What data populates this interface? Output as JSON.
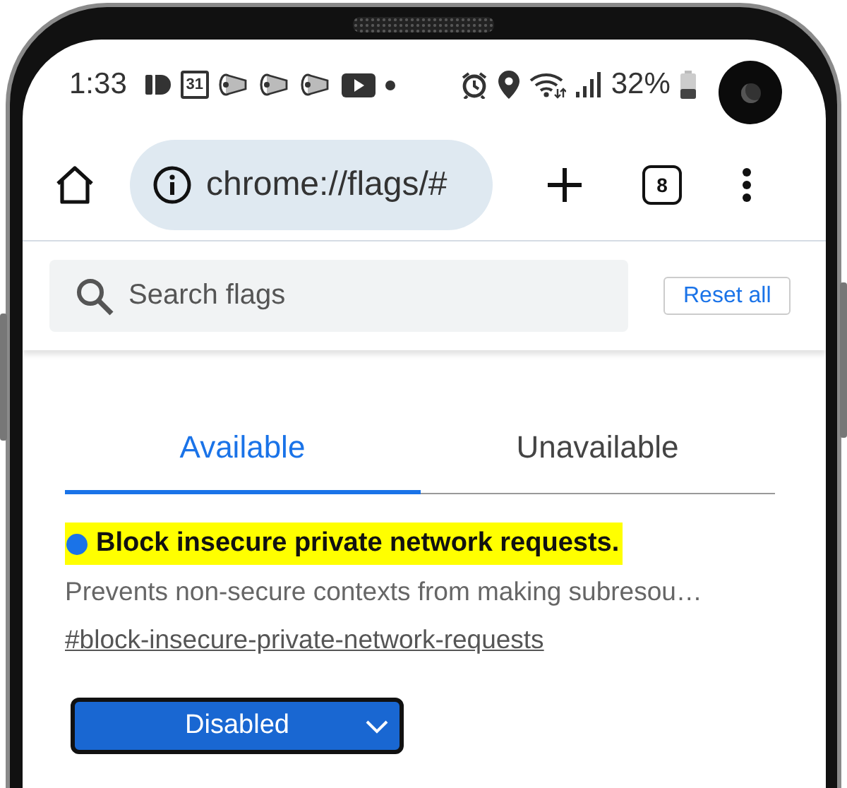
{
  "status_bar": {
    "time": "1:33",
    "calendar_day": "31",
    "battery": "32%"
  },
  "toolbar": {
    "url": "chrome://flags/#",
    "tab_count": "8"
  },
  "search": {
    "placeholder": "Search flags"
  },
  "reset_button": "Reset all",
  "tabs": [
    {
      "label": "Available",
      "selected": true
    },
    {
      "label": "Unavailable",
      "selected": false
    }
  ],
  "flags": [
    {
      "title": "Block insecure private network requests.",
      "highlighted": true,
      "modified": true,
      "description": "Prevents non-secure contexts from making subresou…",
      "link": "#block-insecure-private-network-requests",
      "value": "Disabled"
    }
  ]
}
